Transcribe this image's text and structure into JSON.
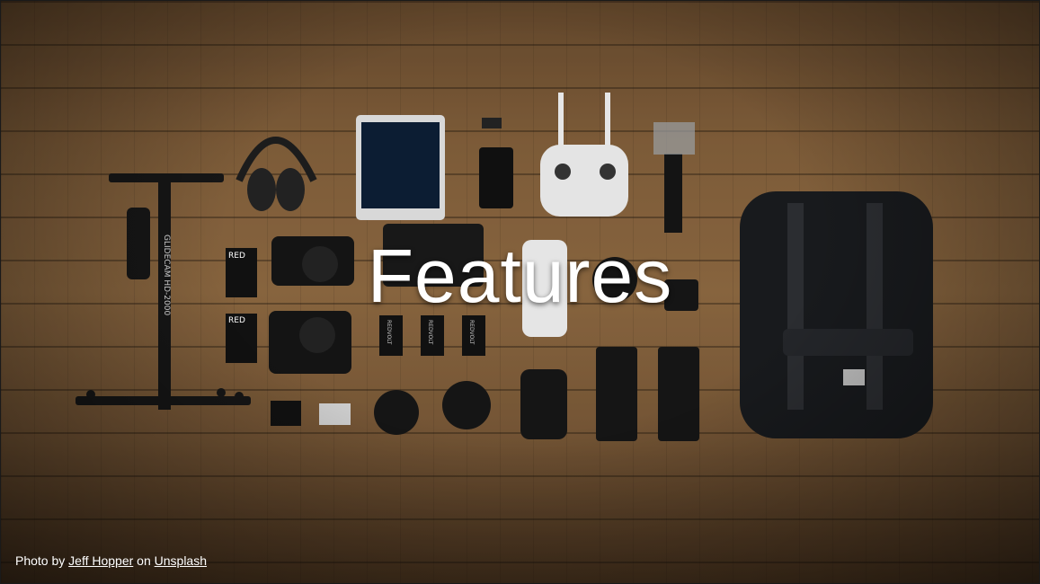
{
  "slide": {
    "title": "Features",
    "credit": {
      "prefix": "Photo by",
      "author_link": "Jeff Hopper",
      "middle": "on",
      "source_link": "Unsplash"
    },
    "photo_labels": {
      "stabilizer_brand": "GLIDECAM HD-2000",
      "battery_brand_1": "RED",
      "battery_brand_2": "RED",
      "vbattery_1": "REDVOLT",
      "vbattery_2": "REDVOLT",
      "vbattery_3": "REDVOLT"
    }
  }
}
